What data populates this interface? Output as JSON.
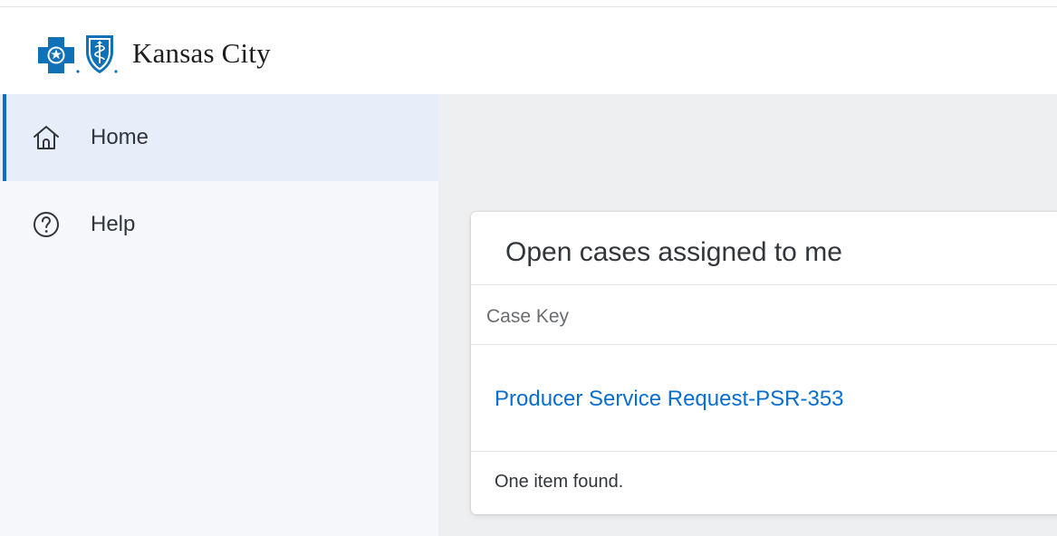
{
  "header": {
    "brand_text": "Kansas City",
    "logo_icons": [
      "blue-cross-logo-icon",
      "blue-shield-logo-icon"
    ]
  },
  "sidebar": {
    "items": [
      {
        "label": "Home",
        "icon": "home-icon",
        "active": true
      },
      {
        "label": "Help",
        "icon": "help-circle-icon",
        "active": false
      }
    ]
  },
  "card": {
    "title": "Open cases assigned to me",
    "column_header": "Case Key",
    "rows": [
      {
        "case_key": "Producer Service Request-PSR-353"
      }
    ],
    "footer": "One item found."
  },
  "colors": {
    "accent": "#0a6ed1",
    "sidebar_bg": "#f5f7fa",
    "sidebar_active_bg": "#e6eff9",
    "main_bg": "#edeff0",
    "logo_blue": "#0f72b9"
  }
}
